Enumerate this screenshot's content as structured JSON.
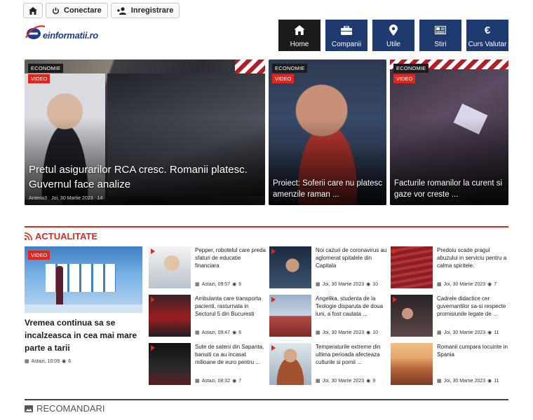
{
  "topbar": {
    "connect": "Conectare",
    "register": "Inregistrare"
  },
  "logo": {
    "text": "einformatii.ro"
  },
  "nav": [
    {
      "label": "Home",
      "icon": "home-icon"
    },
    {
      "label": "Companii",
      "icon": "briefcase-icon"
    },
    {
      "label": "Utile",
      "icon": "map-pin-icon"
    },
    {
      "label": "Stiri",
      "icon": "newspaper-icon"
    },
    {
      "label": "Curs Valutar",
      "icon": "euro-icon"
    }
  ],
  "hero": [
    {
      "category": "ECONOMIE",
      "badge": "VIDEO",
      "title": "Pretul asigurarilor RCA cresc. Romanii platesc. Guvernul face analize",
      "source": "Antena3",
      "date": "Joi, 30 Martie 2023",
      "views": "14"
    },
    {
      "category": "ECONOMIE",
      "badge": "VIDEO",
      "title": "Proiect: Soferii care nu platesc amenzile raman ..."
    },
    {
      "category": "ECONOMIE",
      "badge": "VIDEO",
      "title": "Facturile romanilor la curent si gaze vor creste ..."
    }
  ],
  "section": {
    "title": "ACTUALITATE"
  },
  "feature": {
    "badge": "VIDEO",
    "title": "Vremea continua sa se incalzeasca in cea mai mare parte a tarii",
    "date": "Astazi, 10:09",
    "views": "6"
  },
  "cards": [
    {
      "title": "Pepper, robotelul care preda sfaturi de educatie financiara",
      "date": "Astazi, 09:57",
      "views": "6"
    },
    {
      "title": "Noi cazuri de coronavirus au aglomerat spitalele din Capitala",
      "date": "Joi, 30 Martie 2023",
      "views": "10"
    },
    {
      "title": "Predoiu scade pragul abuzului in serviciu pentru a calma spiritele.",
      "date": "Joi, 30 Martie 2023",
      "views": "7"
    },
    {
      "title": "Ambulanta care transporta pacienti, rasturnata in Sectorul 5 din Bucuresti",
      "date": "Astazi, 09:47",
      "views": "6"
    },
    {
      "title": "Angelika, studenta de la Teologie disparuta de doua luni, a fost cautata ...",
      "date": "Joi, 30 Martie 2023",
      "views": "10"
    },
    {
      "title": "Cadrele didactice cer guvernantilor sa-si respecte promisiunile legate de ...",
      "date": "Joi, 30 Martie 2023",
      "views": "11"
    },
    {
      "title": "Sute de sateni din Sapanta, banuiti ca au incasat milioane de euro pentru ...",
      "date": "Astazi, 08:32",
      "views": "7"
    },
    {
      "title": "Temperaturile extreme din ultima perioada afecteaza culturile si pomii ...",
      "date": "Joi, 30 Martie 2023",
      "views": "9"
    },
    {
      "title": "Romanii cumpara locuinte in Spania",
      "date": "Joi, 30 Martie 2023",
      "views": "11"
    }
  ],
  "recommend": {
    "title": "RECOMANDARI"
  }
}
